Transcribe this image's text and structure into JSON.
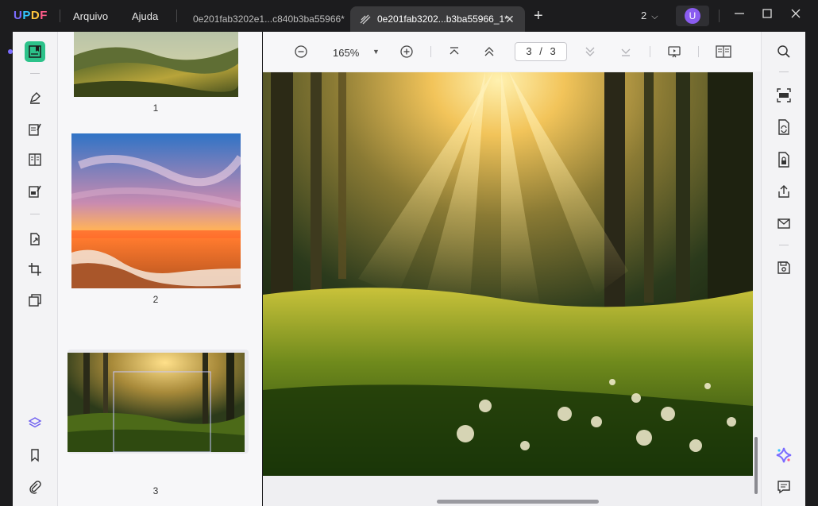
{
  "app": {
    "logo": "UPDF"
  },
  "menu": {
    "file": "Arquivo",
    "help": "Ajuda"
  },
  "tabs": [
    {
      "label": "0e201fab3202e1...c840b3ba55966*",
      "active": false
    },
    {
      "label": "0e201fab3202...b3ba55966_1*",
      "active": true
    }
  ],
  "window": {
    "count": "2",
    "user_initial": "U"
  },
  "toolbar": {
    "zoom": "165%",
    "current_page": "3",
    "page_separator": "/",
    "total_pages": "3"
  },
  "thumbnails": [
    {
      "number": "1"
    },
    {
      "number": "2"
    },
    {
      "number": "3",
      "selected": true
    }
  ],
  "colors": {
    "accent": "#2cc28a",
    "brand": "#7b6cff",
    "avatar": "#8a5cf0"
  }
}
